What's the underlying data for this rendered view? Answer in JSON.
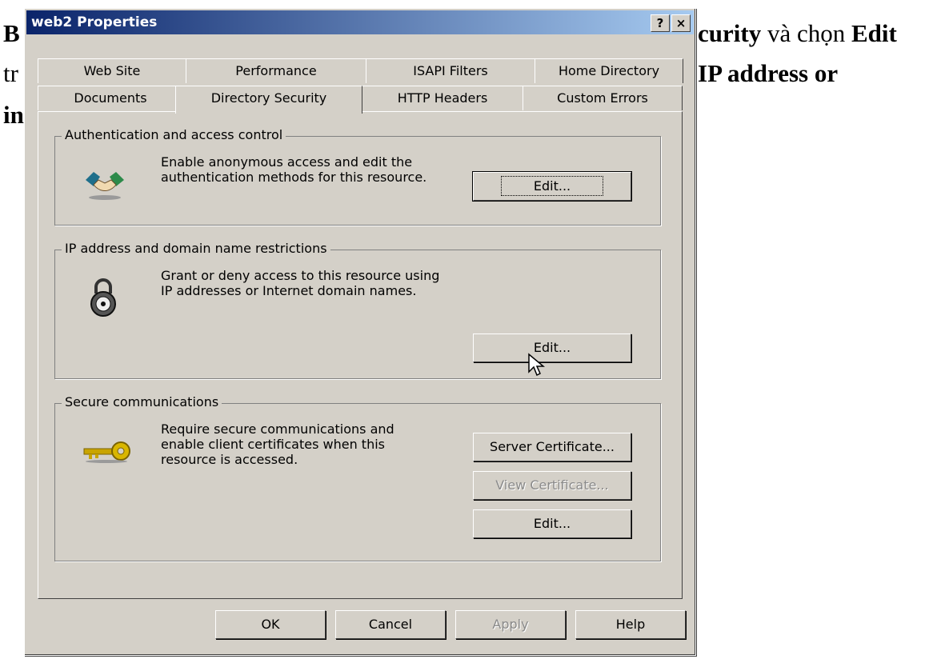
{
  "background_text": {
    "line1_left": "B",
    "line1_right_bold1": "curity",
    "line1_right_plain": " và chọn ",
    "line1_right_bold2": "Edit",
    "line2_left": "tr",
    "line2_right_bold": "IP address or",
    "line3_left": "in"
  },
  "window": {
    "title": "web2 Properties",
    "help_btn": "?",
    "close_btn": "×"
  },
  "tabs_row1": [
    "Web Site",
    "Performance",
    "ISAPI Filters",
    "Home Directory"
  ],
  "tabs_row2": [
    "Documents",
    "Directory Security",
    "HTTP Headers",
    "Custom Errors"
  ],
  "active_tab": "Directory Security",
  "auth": {
    "legend": "Authentication and access control",
    "line1": "Enable anonymous access and edit the",
    "line2": "authentication methods for this resource.",
    "edit": "Edit..."
  },
  "ip": {
    "legend": "IP address and domain name restrictions",
    "line1": "Grant or deny access to this resource using",
    "line2": "IP addresses or Internet domain names.",
    "edit": "Edit..."
  },
  "secure": {
    "legend": "Secure communications",
    "line1": "Require secure communications and",
    "line2": "enable client certificates when this",
    "line3": "resource is accessed.",
    "server_cert": "Server Certificate...",
    "view_cert": "View Certificate...",
    "edit": "Edit..."
  },
  "footer": {
    "ok": "OK",
    "cancel": "Cancel",
    "apply": "Apply",
    "help": "Help"
  },
  "icons": [
    "handshake-icon",
    "padlock-icon",
    "key-icon",
    "mouse-cursor-icon"
  ]
}
